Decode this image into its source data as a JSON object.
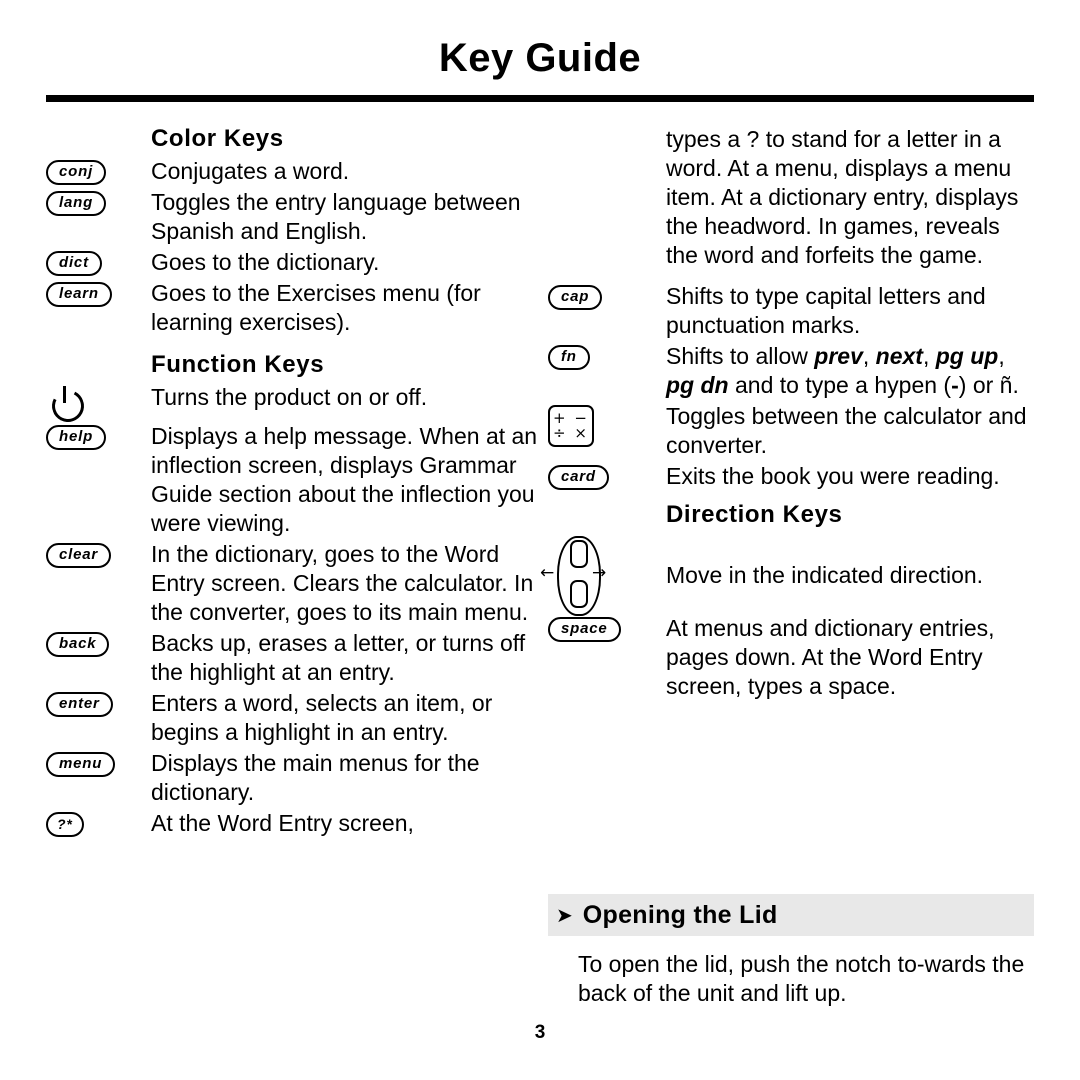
{
  "header": {
    "title": "Key Guide"
  },
  "left_column": {
    "sections": [
      {
        "heading": "Color Keys",
        "entries": [
          {
            "key": "conj",
            "text": "Conjugates a word."
          },
          {
            "key": "lang",
            "text": "Toggles the entry language between Spanish and English."
          },
          {
            "key": "dict",
            "text": "Goes to the dictionary."
          },
          {
            "key": "learn",
            "text": "Goes to the Exercises menu (for learning exercises)."
          }
        ]
      },
      {
        "heading": "Function Keys",
        "entries": [
          {
            "key": "power-icon",
            "text": "Turns the product on or off."
          },
          {
            "key": "help",
            "text": "Displays a help message. When at an inflection screen, displays Grammar Guide section about the inflection you were viewing."
          },
          {
            "key": "clear",
            "text": "In the dictionary, goes to the Word Entry screen. Clears the calculator. In the converter, goes to its main menu."
          },
          {
            "key": "back",
            "text": "Backs up, erases a letter, or turns off the highlight at an entry."
          },
          {
            "key": "enter",
            "text": "Enters a word, selects an item, or begins a highlight in an entry."
          },
          {
            "key": "menu",
            "text": "Displays the main menus for the dictionary."
          },
          {
            "key": "?*",
            "text": "At the Word Entry screen,"
          }
        ]
      }
    ]
  },
  "right_column": {
    "continuation": "types a ? to stand for a letter in a word. At a menu, displays a menu item. At a dictionary entry, displays the headword. In games, reveals the word and forfeits the game.",
    "entries": [
      {
        "key": "cap",
        "text": "Shifts to type capital letters and punctuation marks."
      },
      {
        "key": "fn",
        "text_parts": [
          {
            "t": "Shifts to allow ",
            "style": "plain"
          },
          {
            "t": "prev",
            "style": "bolditalic"
          },
          {
            "t": ", ",
            "style": "plain"
          },
          {
            "t": "next",
            "style": "bolditalic"
          },
          {
            "t": ", ",
            "style": "plain"
          },
          {
            "t": "pg up",
            "style": "bolditalic"
          },
          {
            "t": ", ",
            "style": "plain"
          },
          {
            "t": "pg dn",
            "style": "bolditalic"
          },
          {
            "t": " and to type a hypen (",
            "style": "plain"
          },
          {
            "t": "-",
            "style": "bold"
          },
          {
            "t": ") or ñ.",
            "style": "plain"
          }
        ]
      },
      {
        "key": "calculator-icon",
        "text": "Toggles between the calculator and converter."
      },
      {
        "key": "card",
        "text": "Exits the book you were reading."
      }
    ],
    "direction_section": {
      "heading": "Direction Keys",
      "entries": [
        {
          "key": "direction-pad-icon",
          "text": "Move in the indicated direction."
        },
        {
          "key": "space",
          "text": "At menus and dictionary entries, pages down. At the Word Entry screen, types a space."
        }
      ]
    },
    "banner": {
      "arrow": "➤",
      "title": "Opening the Lid",
      "body": "To open the lid, push the notch to-wards the back of the unit and lift up."
    }
  },
  "footer": {
    "page_number": "3"
  },
  "key_labels": {
    "calculator_top": "+ −",
    "calculator_bottom": "÷ ×",
    "arrow_left": "←",
    "arrow_right": "→"
  }
}
